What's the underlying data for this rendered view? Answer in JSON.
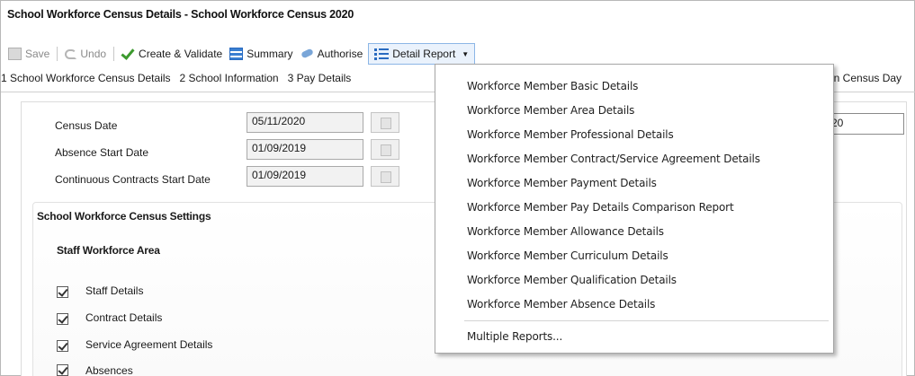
{
  "window": {
    "title": "School Workforce Census Details - School Workforce Census 2020"
  },
  "toolbar": {
    "save": "Save",
    "undo": "Undo",
    "create_validate": "Create & Validate",
    "summary": "Summary",
    "authorise": "Authorise",
    "detail_report": "Detail Report"
  },
  "tabs": [
    "1 School Workforce Census Details",
    "2 School Information",
    "3 Pay Details"
  ],
  "tab_overflow_text": "on Census Day",
  "fields": {
    "census_date": {
      "label": "Census Date",
      "value": "05/11/2020"
    },
    "absence_start": {
      "label": "Absence Start Date",
      "value": "01/09/2019"
    },
    "contracts_start": {
      "label": "Continuous Contracts Start Date",
      "value": "01/09/2019"
    },
    "right_input_value": "20"
  },
  "settings": {
    "title": "School Workforce Census Settings",
    "area_title": "Staff Workforce Area",
    "checkboxes": [
      {
        "label": "Staff Details",
        "checked": true
      },
      {
        "label": "Contract Details",
        "checked": true
      },
      {
        "label": "Service Agreement Details",
        "checked": true
      },
      {
        "label": "Absences",
        "checked": true
      }
    ]
  },
  "detail_menu": {
    "items": [
      "Workforce Member Basic Details",
      "Workforce Member Area Details",
      "Workforce Member Professional Details",
      "Workforce Member Contract/Service Agreement Details",
      "Workforce Member Payment Details",
      "Workforce Member Pay Details Comparison Report",
      "Workforce Member Allowance Details",
      "Workforce Member Curriculum Details",
      "Workforce Member Qualification Details",
      "Workforce Member Absence Details"
    ],
    "multiple": "Multiple Reports..."
  }
}
